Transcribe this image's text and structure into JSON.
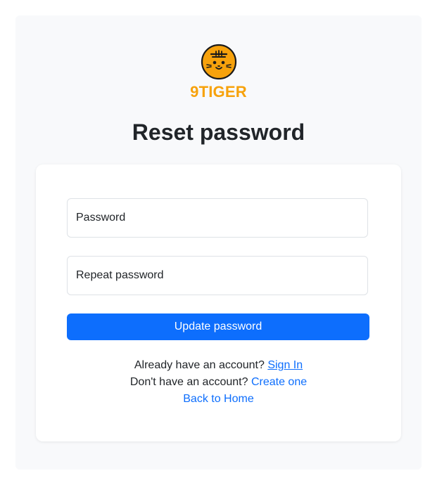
{
  "brand": {
    "name": "9TIGER",
    "color": "#f7a20c",
    "logo_icon": "tiger-face-icon"
  },
  "page": {
    "title": "Reset password"
  },
  "form": {
    "password_placeholder": "Password",
    "repeat_password_placeholder": "Repeat password",
    "submit_label": "Update password",
    "submit_color": "#0d6efd"
  },
  "footer_links": {
    "signin_prompt": "Already have an account?",
    "signin_link": "Sign In",
    "signup_prompt": "Don't have an account?",
    "signup_link": "Create one",
    "home_link": "Back to Home"
  }
}
